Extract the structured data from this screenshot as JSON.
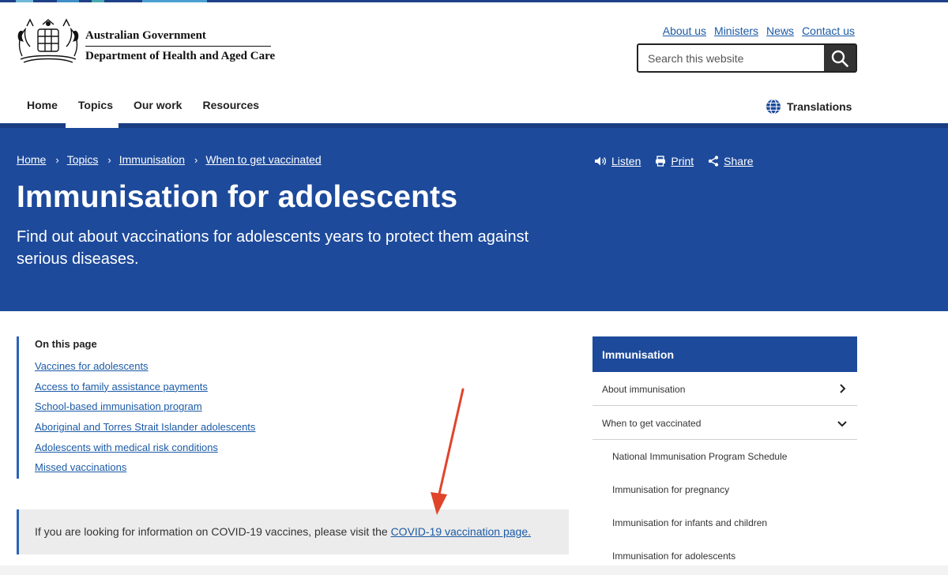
{
  "colors": {
    "brand_blue": "#1d4a9b",
    "link": "#1b5aa6",
    "annotation_arrow": "#e0452a"
  },
  "header": {
    "logo_line1": "Australian Government",
    "logo_line2": "Department of Health and Aged Care",
    "utility_links": [
      "About us",
      "Ministers",
      "News",
      "Contact us"
    ],
    "search_placeholder": "Search this website",
    "search_icon": "search-icon",
    "nav": [
      "Home",
      "Topics",
      "Our work",
      "Resources"
    ],
    "active_nav": "Topics",
    "translations_label": "Translations",
    "translations_icon": "globe-icon"
  },
  "hero": {
    "breadcrumb": [
      "Home",
      "Topics",
      "Immunisation",
      "When to get vaccinated"
    ],
    "actions": {
      "listen": "Listen",
      "print": "Print",
      "share": "Share"
    },
    "title": "Immunisation for adolescents",
    "intro": "Find out about vaccinations for adolescents years to protect them against serious diseases."
  },
  "on_this_page": {
    "title": "On this page",
    "links": [
      "Vaccines for adolescents",
      "Access to family assistance payments",
      "School-based immunisation program",
      "Aboriginal and Torres Strait Islander adolescents",
      "Adolescents with medical risk conditions",
      "Missed vaccinations"
    ]
  },
  "callout": {
    "text": "If you are looking for information on COVID-19 vaccines, please visit the ",
    "link": "COVID-19 vaccination page."
  },
  "sidenav": {
    "heading": "Immunisation",
    "items": [
      {
        "label": "About immunisation",
        "icon": "chevron-right-icon"
      },
      {
        "label": "When to get vaccinated",
        "icon": "chevron-down-icon"
      }
    ],
    "subitems": [
      "National Immunisation Program Schedule",
      "Immunisation for pregnancy",
      "Immunisation for infants and children",
      "Immunisation for adolescents"
    ]
  }
}
